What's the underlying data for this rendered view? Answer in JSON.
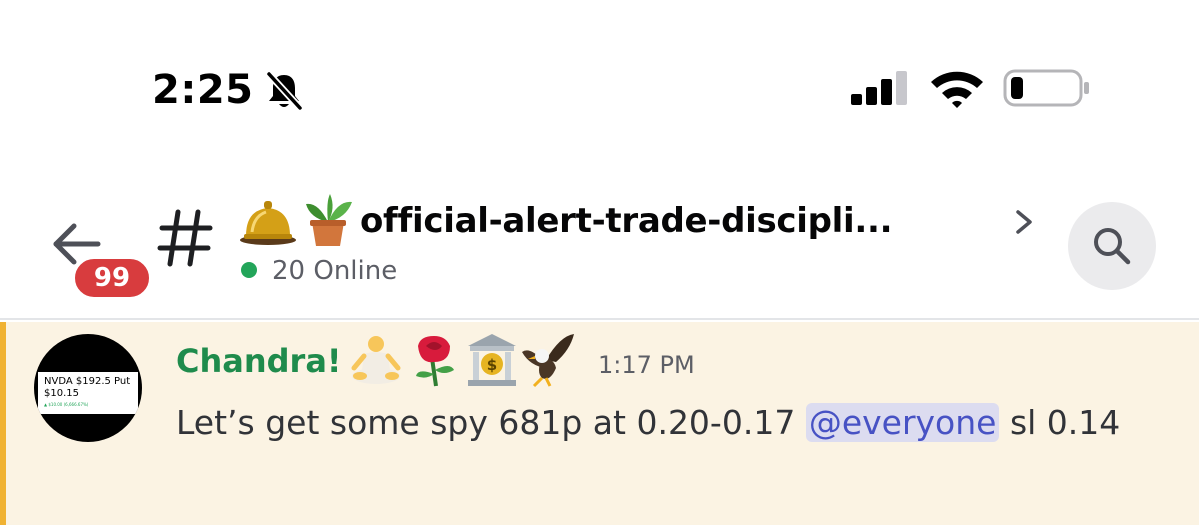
{
  "status_bar": {
    "time": "2:25",
    "icons": [
      "bell-slash-icon",
      "cellular-signal-icon",
      "wifi-icon",
      "battery-low-icon"
    ]
  },
  "header": {
    "back_icon": "arrow-left-icon",
    "unread_count": "99",
    "channel_prefix_icon": "hash-icon",
    "channel_emojis": [
      "bell-emoji",
      "potted-plant-emoji"
    ],
    "channel_name": "official-alert-trade-discipli...",
    "online_status": "20 Online",
    "online_color": "#23a55a",
    "chevron_icon": "chevron-right-icon",
    "search_icon": "search-icon"
  },
  "message": {
    "author": "Chandra!",
    "author_color": "#1f8b4c",
    "author_emojis": [
      "person-meditating-emoji",
      "rose-emoji",
      "bank-emoji",
      "eagle-emoji"
    ],
    "time": "1:17 PM",
    "text_before": "Let’s get some spy 681p at 0.20-0.17 ",
    "mention": "@everyone",
    "text_after": " sl 0.14",
    "highlight_color": "#fbf3e3",
    "mention_bar_color": "#f0b232",
    "avatar": {
      "line1": "NVDA $192.5 Put",
      "line2": "$10.15",
      "line3": "▲ $10.00 (6,666.67%)"
    }
  }
}
